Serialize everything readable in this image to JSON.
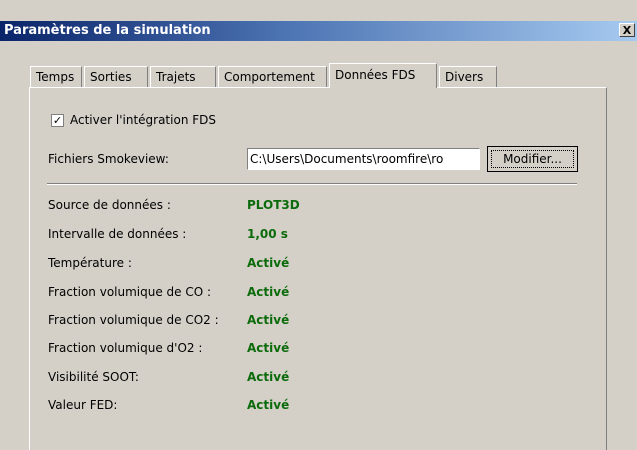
{
  "window": {
    "title": "Paramètres de la simulation",
    "close_glyph": "X"
  },
  "tabs": [
    {
      "label": "Temps"
    },
    {
      "label": "Sorties"
    },
    {
      "label": "Trajets"
    },
    {
      "label": "Comportement"
    },
    {
      "label": "Données FDS",
      "active": true
    },
    {
      "label": "Divers"
    }
  ],
  "fds": {
    "enable_label": "Activer l'intégration FDS",
    "enabled": true,
    "smokeview_label": "Fichiers Smokeview:",
    "smokeview_path": "C:\\Users\\Documents\\roomfire\\ro",
    "modify_label": "Modifier..."
  },
  "info": [
    {
      "label": "Source de données :",
      "value": "PLOT3D"
    },
    {
      "label": "Intervalle de données :",
      "value": "1,00 s"
    },
    {
      "label": "Température :",
      "value": "Activé"
    },
    {
      "label": "Fraction volumique de CO :",
      "value": "Activé"
    },
    {
      "label": "Fraction volumique de CO2 :",
      "value": "Activé"
    },
    {
      "label": "Fraction volumique d'O2 :",
      "value": "Activé"
    },
    {
      "label": "Visibilité SOOT:",
      "value": "Activé"
    },
    {
      "label": "Valeur FED:",
      "value": "Activé"
    }
  ],
  "colors": {
    "value_text": "#0b6b0b",
    "title_bar": "#0a246a"
  }
}
